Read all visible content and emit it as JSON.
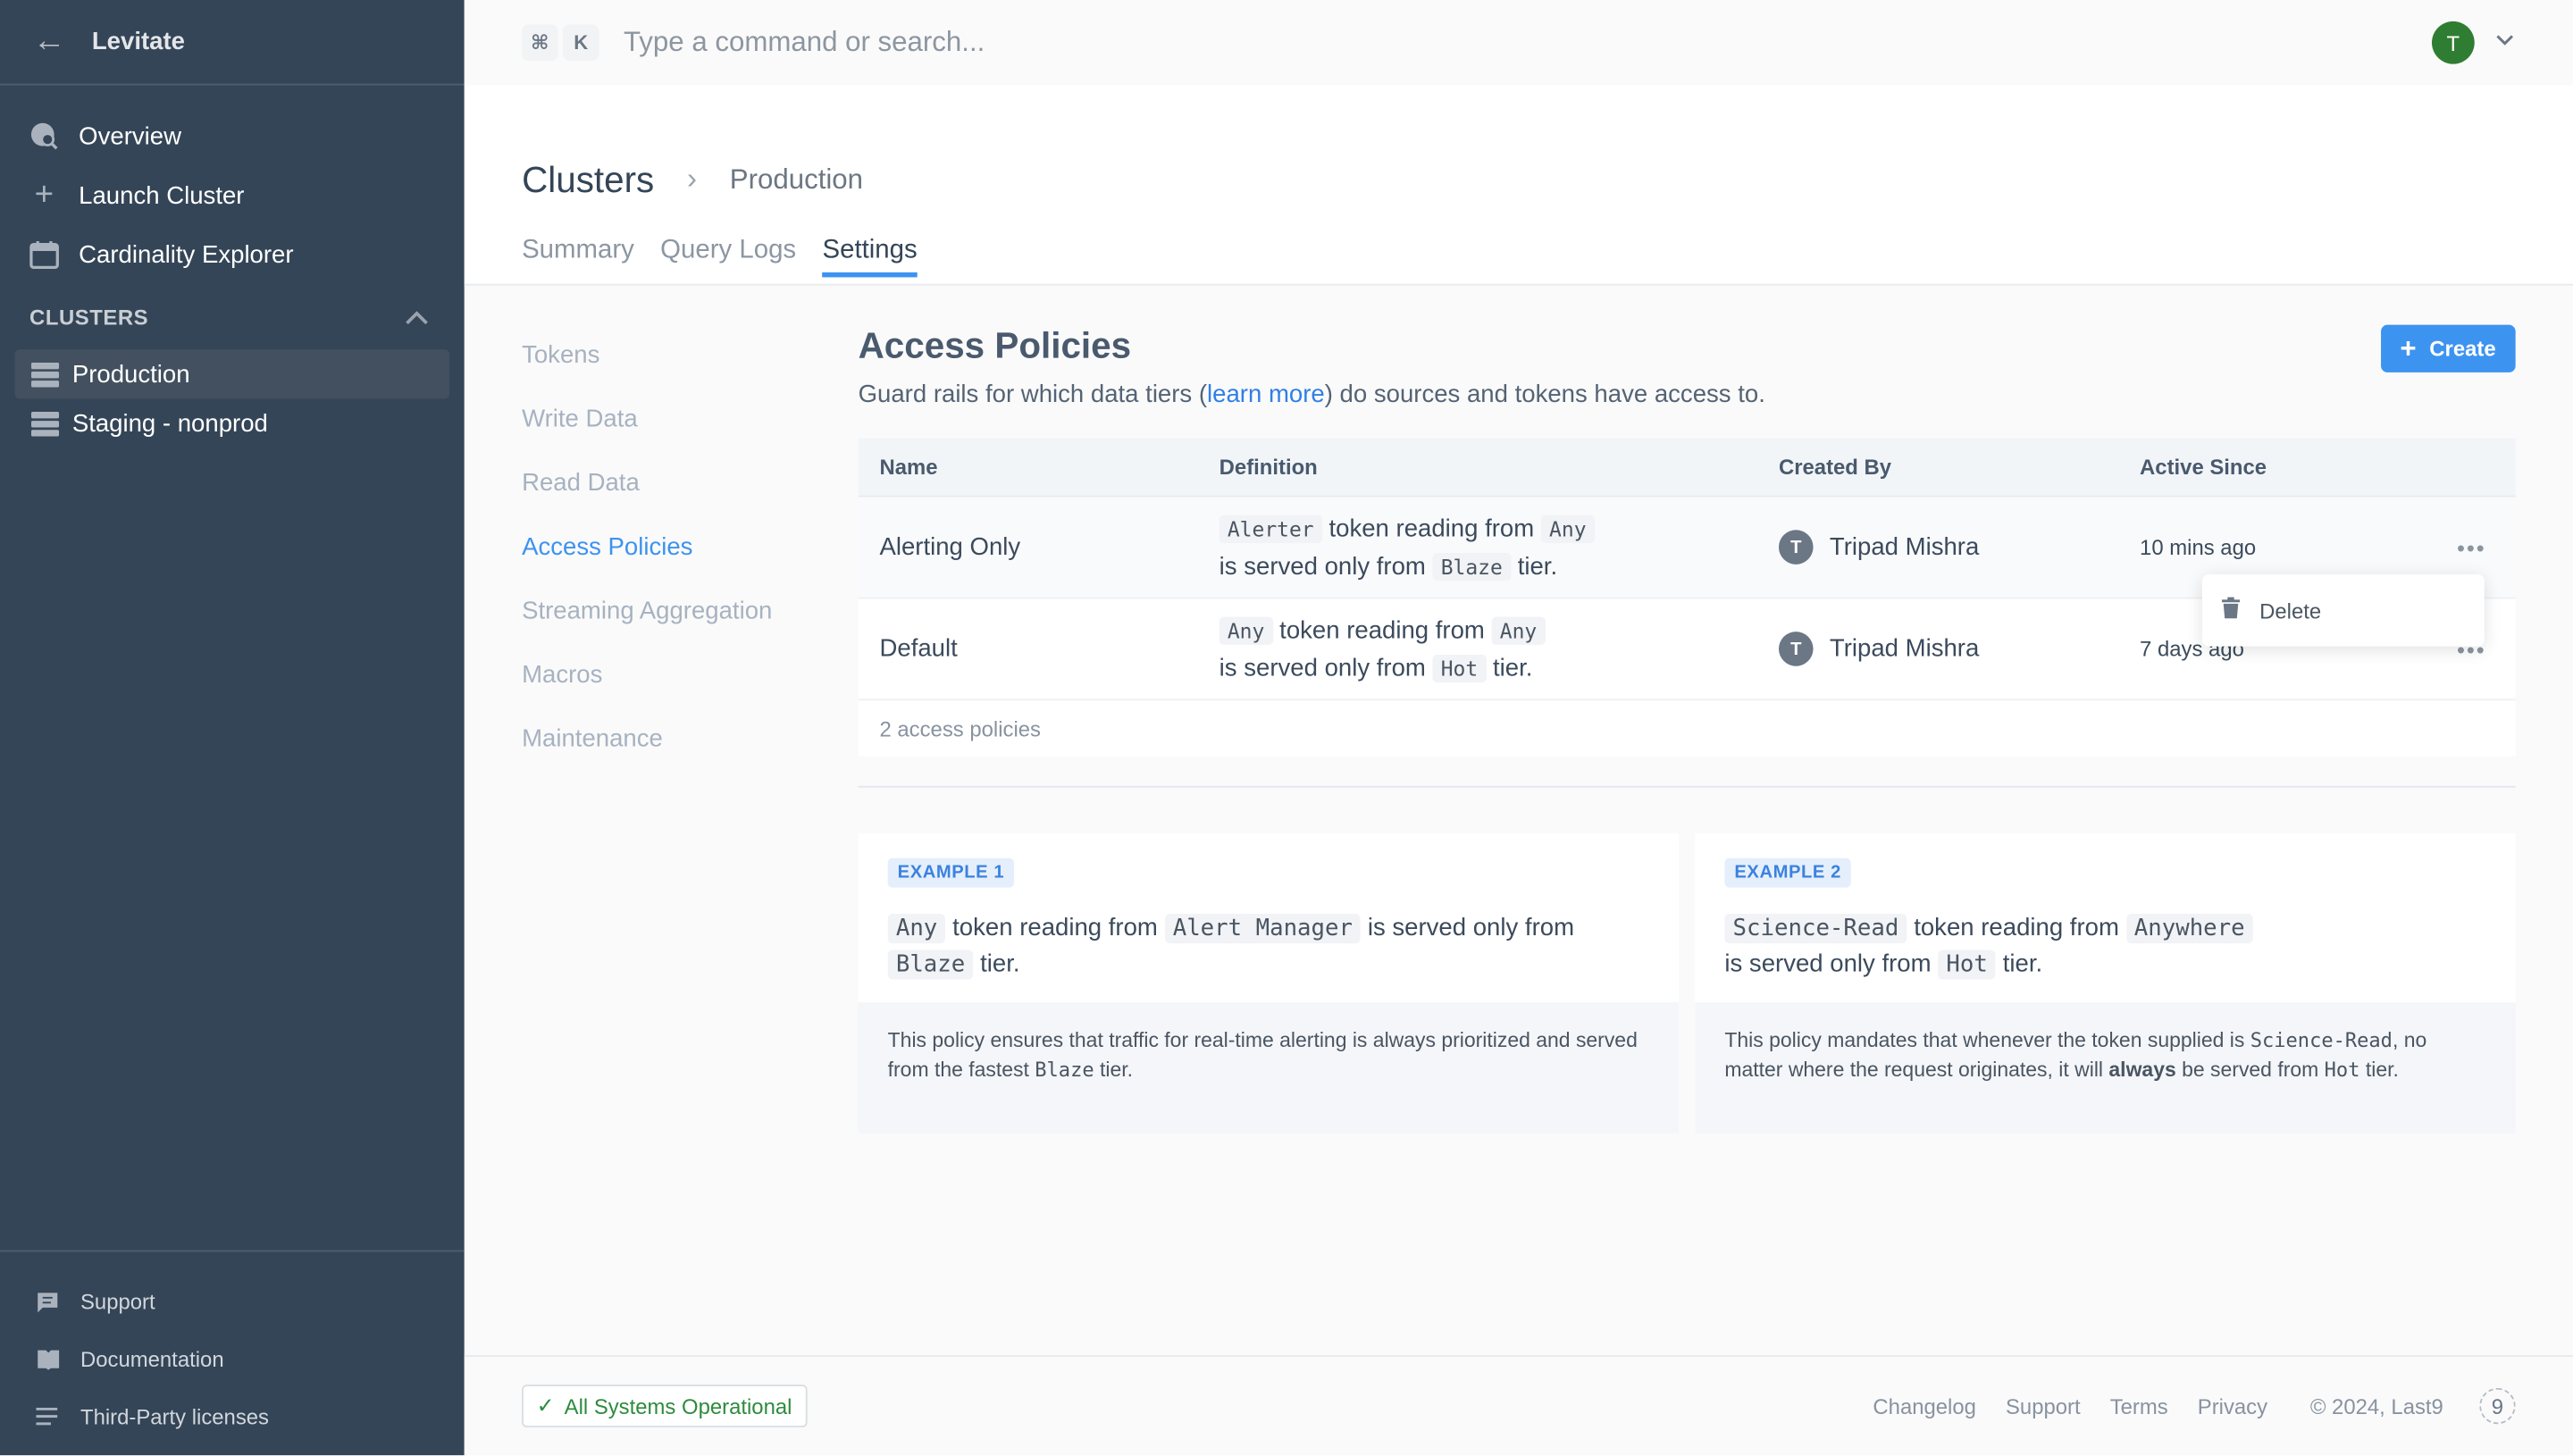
{
  "sidebar": {
    "title": "Levitate",
    "nav": [
      {
        "label": "Overview",
        "icon": "globe-search-icon"
      },
      {
        "label": "Launch Cluster",
        "icon": "plus-icon"
      },
      {
        "label": "Cardinality Explorer",
        "icon": "calendar-icon"
      }
    ],
    "section_label": "CLUSTERS",
    "clusters": [
      {
        "label": "Production",
        "active": true
      },
      {
        "label": "Staging - nonprod",
        "active": false
      }
    ],
    "footer": [
      {
        "label": "Support",
        "icon": "chat-icon"
      },
      {
        "label": "Documentation",
        "icon": "book-icon"
      },
      {
        "label": "Third-Party licenses",
        "icon": "list-icon"
      }
    ]
  },
  "topbar": {
    "kbd1": "⌘",
    "kbd2": "K",
    "search_placeholder": "Type a command or search...",
    "avatar_initial": "T"
  },
  "header": {
    "breadcrumb_root": "Clusters",
    "breadcrumb_current": "Production",
    "tabs": [
      "Summary",
      "Query Logs",
      "Settings"
    ],
    "active_tab": "Settings"
  },
  "subnav": [
    "Tokens",
    "Write Data",
    "Read Data",
    "Access Policies",
    "Streaming Aggregation",
    "Macros",
    "Maintenance"
  ],
  "panel": {
    "title": "Access Policies",
    "desc_before": "Guard rails for which data tiers (",
    "desc_link": "learn more",
    "desc_after": ") do sources and tokens have access to.",
    "create_label": "Create"
  },
  "table": {
    "columns": [
      "Name",
      "Definition",
      "Created By",
      "Active Since"
    ],
    "rows": [
      {
        "name": "Alerting Only",
        "token": "Alerter",
        "source": "Any",
        "tier": "Blaze",
        "created_by": "Tripad Mishra",
        "initial": "T",
        "active_since": "10 mins ago"
      },
      {
        "name": "Default",
        "token": "Any",
        "source": "Any",
        "tier": "Hot",
        "created_by": "Tripad Mishra",
        "initial": "T",
        "active_since": "7 days ago"
      }
    ],
    "def_text": {
      "a": "token reading from",
      "b": "is served only from",
      "c": "tier."
    },
    "footer": "2 access policies",
    "menu_delete": "Delete"
  },
  "examples": [
    {
      "badge": "EXAMPLE 1",
      "token": "Any",
      "source": "Alert Manager",
      "tier": "Blaze",
      "t1": "token reading from",
      "t2": "is served only from",
      "t3": "tier.",
      "note_before": "This policy ensures that traffic for real-time alerting is always prioritized and served from the fastest ",
      "note_code": "Blaze",
      "note_after": " tier."
    },
    {
      "badge": "EXAMPLE 2",
      "token": "Science-Read",
      "source": "Anywhere",
      "tier": "Hot",
      "t1": "token reading from",
      "t2": "is served only from",
      "t3": "tier.",
      "note_before": "This policy mandates that whenever the token supplied is ",
      "note_code": "Science-Read",
      "note_mid": ", no matter where the request originates, it will ",
      "note_bold": "always",
      "note_after2": " be served from ",
      "note_code2": "Hot",
      "note_end": " tier."
    }
  ],
  "footer": {
    "status": "All Systems Operational",
    "links": [
      "Changelog",
      "Support",
      "Terms",
      "Privacy"
    ],
    "copyright": "© 2024, Last9",
    "logo": "9",
    "status_color": "#2e8b3e"
  }
}
